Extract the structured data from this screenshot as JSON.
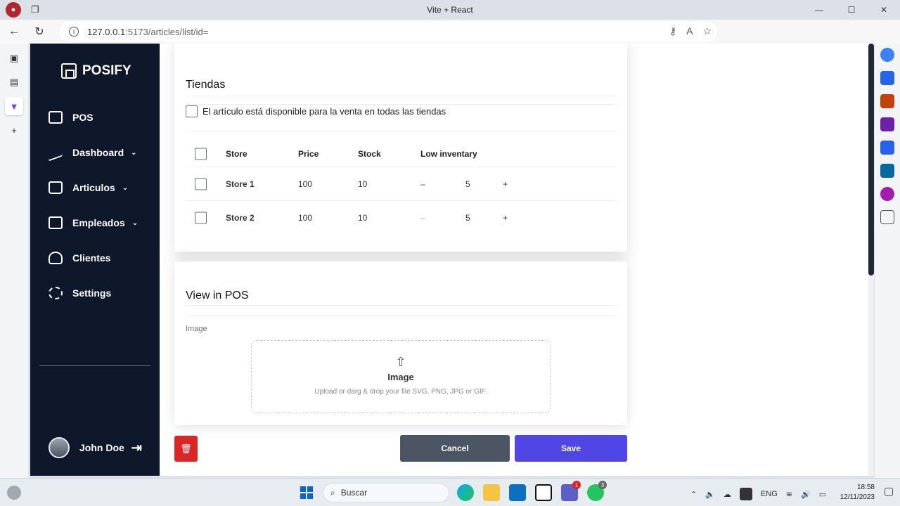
{
  "browser": {
    "title": "Vite + React",
    "url_host": "127.0.0.1",
    "url_path": ":5173/articles/list/id="
  },
  "sidebar": {
    "brand": "POSIFY",
    "items": [
      {
        "label": "POS",
        "icon": "store-icon",
        "chevron": false
      },
      {
        "label": "Dashboard",
        "icon": "chart-icon",
        "chevron": true
      },
      {
        "label": "Articulos",
        "icon": "bag-icon",
        "chevron": true
      },
      {
        "label": "Empleados",
        "icon": "id-card-icon",
        "chevron": true
      },
      {
        "label": "Clientes",
        "icon": "user-icon",
        "chevron": false
      },
      {
        "label": "Settings",
        "icon": "gear-icon",
        "chevron": false
      }
    ],
    "user_name": "John Doe"
  },
  "stores_section": {
    "title": "Tiendas",
    "all_stores_label": "El artículo está disponible para la venta en todas las tiendas",
    "columns": [
      "Store",
      "Price",
      "Stock",
      "Low inventary"
    ],
    "rows": [
      {
        "store": "Store 1",
        "price": "100",
        "stock": "10",
        "minus": "–",
        "low": "5",
        "plus": "+"
      },
      {
        "store": "Store 2",
        "price": "100",
        "stock": "10",
        "minus": "–",
        "low": "5",
        "plus": "+"
      }
    ]
  },
  "pos_section": {
    "title": "View in POS",
    "image_label": "Image",
    "dropzone_title": "Image",
    "dropzone_hint": "Upload or darg & drop your file SVG, PNG, JPG or GIF."
  },
  "actions": {
    "cancel": "Cancel",
    "save": "Save"
  },
  "taskbar": {
    "search_placeholder": "Buscar",
    "lang": "ENG",
    "time": "18:58",
    "date": "12/11/2023",
    "teams_badge": "1",
    "whatsapp_badge": "3"
  }
}
